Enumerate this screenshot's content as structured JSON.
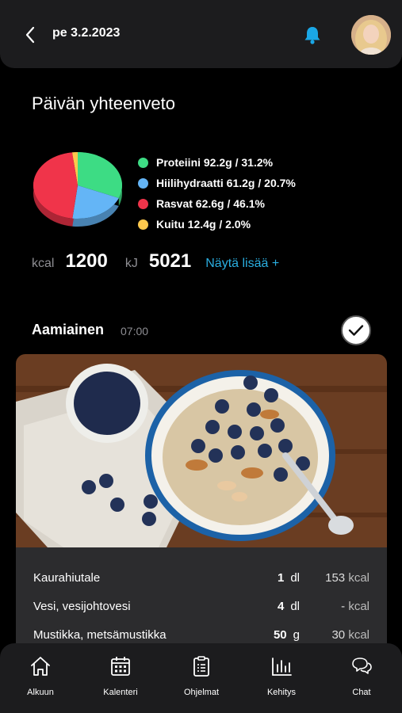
{
  "header": {
    "date": "pe 3.2.2023"
  },
  "summary": {
    "title": "Päivän yhteenveto",
    "legend": [
      {
        "label": "Proteiini 92.2g / 31.2%",
        "color": "#3ddc84"
      },
      {
        "label": "Hiilihydraatti 61.2g / 20.7%",
        "color": "#64b5f6"
      },
      {
        "label": "Rasvat 62.6g / 46.1%",
        "color": "#f0344a"
      },
      {
        "label": "Kuitu 12.4g / 2.0%",
        "color": "#ffc94d"
      }
    ],
    "kcal_label": "kcal",
    "kcal_value": "1200",
    "kj_label": "kJ",
    "kj_value": "5021",
    "show_more": "Näytä lisää +"
  },
  "chart_data": {
    "type": "pie",
    "categories": [
      "Proteiini",
      "Hiilihydraatti",
      "Rasvat",
      "Kuitu"
    ],
    "values": [
      31.2,
      20.7,
      46.1,
      2.0
    ],
    "colors": [
      "#3ddc84",
      "#64b5f6",
      "#f0344a",
      "#ffc94d"
    ]
  },
  "meal": {
    "title": "Aamiainen",
    "time": "07:00",
    "items": [
      {
        "name": "Kaurahiutale",
        "amount": "1",
        "unit": "dl",
        "kcal_value": "153",
        "kcal_unit": "kcal"
      },
      {
        "name": "Vesi, vesijohtovesi",
        "amount": "4",
        "unit": "dl",
        "kcal_value": "-",
        "kcal_unit": "kcal"
      },
      {
        "name": "Mustikka, metsämustikka",
        "amount": "50",
        "unit": "g",
        "kcal_value": "30",
        "kcal_unit": "kcal"
      }
    ]
  },
  "nav": [
    {
      "label": "Alkuun",
      "icon": "home-icon"
    },
    {
      "label": "Kalenteri",
      "icon": "calendar-icon"
    },
    {
      "label": "Ohjelmat",
      "icon": "clipboard-icon"
    },
    {
      "label": "Kehitys",
      "icon": "bar-chart-icon"
    },
    {
      "label": "Chat",
      "icon": "chat-icon"
    }
  ],
  "colors": {
    "accent": "#2aaee0",
    "background": "#000000",
    "surface": "#1c1c1e"
  }
}
